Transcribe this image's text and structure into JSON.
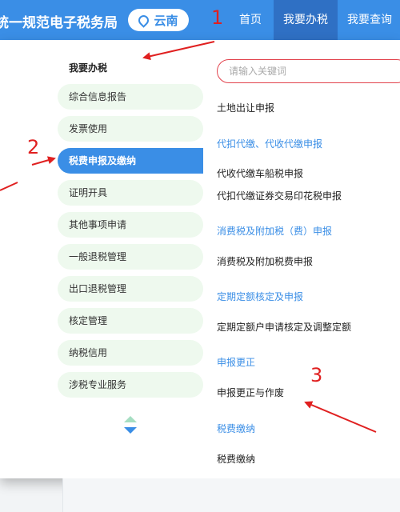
{
  "header": {
    "site_title": "统一规范电子税务局",
    "region": "云南",
    "nav": [
      {
        "label": "首页"
      },
      {
        "label": "我要办税"
      },
      {
        "label": "我要查询"
      }
    ]
  },
  "sidebar": {
    "heading": "我要办税",
    "items": [
      {
        "label": "综合信息报告"
      },
      {
        "label": "发票使用"
      },
      {
        "label": "税费申报及缴纳"
      },
      {
        "label": "证明开具"
      },
      {
        "label": "其他事项申请"
      },
      {
        "label": "一般退税管理"
      },
      {
        "label": "出口退税管理"
      },
      {
        "label": "核定管理"
      },
      {
        "label": "纳税信用"
      },
      {
        "label": "涉税专业服务"
      }
    ],
    "active_index": 2
  },
  "search": {
    "placeholder": "请输入关键词"
  },
  "content": {
    "items": [
      {
        "kind": "sub",
        "label": "土地出让申报"
      },
      {
        "kind": "cat",
        "label": "代扣代缴、代收代缴申报"
      },
      {
        "kind": "sub",
        "label": "代收代缴车船税申报"
      },
      {
        "kind": "sub",
        "label": "代扣代缴证券交易印花税申报"
      },
      {
        "kind": "cat",
        "label": "消费税及附加税（费）申报"
      },
      {
        "kind": "sub",
        "label": "消费税及附加税费申报"
      },
      {
        "kind": "cat",
        "label": "定期定额核定及申报"
      },
      {
        "kind": "sub",
        "label": "定期定额户申请核定及调整定额"
      },
      {
        "kind": "cat",
        "label": "申报更正"
      },
      {
        "kind": "sub",
        "label": "申报更正与作废"
      },
      {
        "kind": "cat",
        "label": "税费缴纳"
      },
      {
        "kind": "sub",
        "label": "税费缴纳"
      }
    ]
  },
  "annotations": [
    {
      "number": "1"
    },
    {
      "number": "2"
    },
    {
      "number": "3"
    }
  ],
  "colors": {
    "header_blue": "#3a8ee6",
    "active_nav": "#2f70c4",
    "menu_bg": "#eef9ee",
    "category_blue": "#3a8ee6",
    "annotation_red": "#e02020",
    "search_border": "#e2434d"
  },
  "icons": {
    "region": "location-pin-icon",
    "scroll": "scroll-arrows-icon"
  }
}
